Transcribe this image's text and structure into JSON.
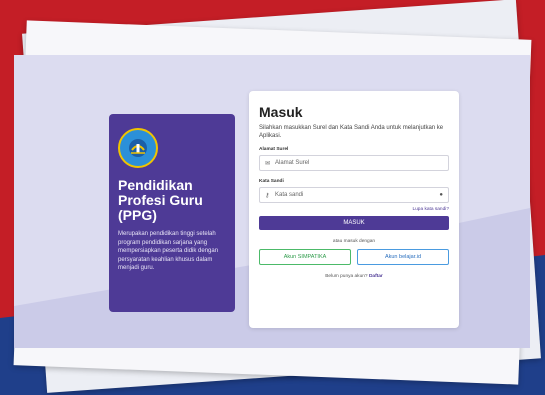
{
  "brand": {
    "title": "Pendidikan Profesi Guru (PPG)",
    "description": "Merupakan pendidikan tinggi setelah program pendidikan sarjana yang mempersiapkan peserta didik dengan persyaratan keahlian khusus dalam menjadi guru."
  },
  "form": {
    "title": "Masuk",
    "subtitle": "Silahkan masukkan Surel dan Kata Sandi Anda untuk melanjutkan ke Aplikasi.",
    "email_label": "Alamat Surel",
    "email_placeholder": "Alamat Surel",
    "password_label": "Kata Sandi",
    "password_placeholder": "Kata sandi",
    "forgot": "Lupa kata sandi?",
    "submit": "MASUK",
    "alt_text": "atau masuk dengan",
    "simpatika": "Akun SIMPATIKA",
    "belajar": "Akun belajar.id",
    "register_prompt": "Belum punya akun?",
    "register_link": "Daftar"
  },
  "colors": {
    "accent": "#4e3a96",
    "background_red": "#c41e26",
    "background_blue": "#1f3f8a",
    "simpatika_green": "#4cba69",
    "belajar_blue": "#4a9be0"
  },
  "icons": {
    "email": "mail-icon",
    "password": "key-icon",
    "toggle": "eye-icon",
    "logo": "tut-wuri-handayani-logo"
  }
}
